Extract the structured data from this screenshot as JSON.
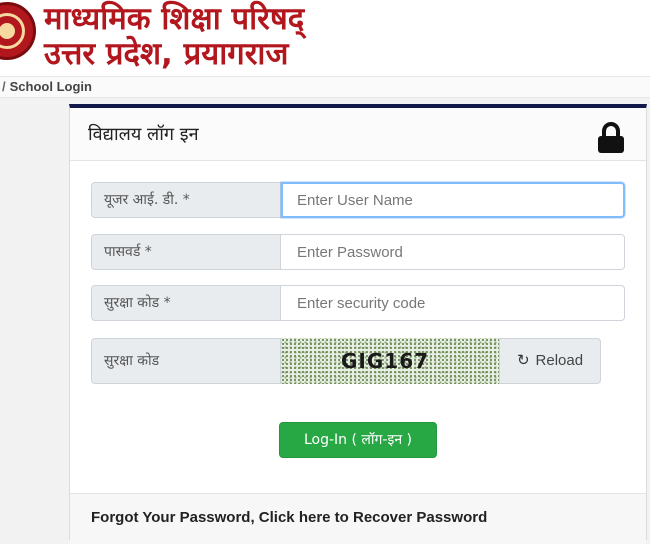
{
  "header": {
    "title_line1": "माध्यमिक शिक्षा परिषद्",
    "title_line2": "उत्तर प्रदेश, प्रयागराज",
    "brand_color": "#b3171e"
  },
  "breadcrumb": {
    "separator": "/",
    "current": "School Login"
  },
  "card": {
    "title": "विद्यालय लॉग इन",
    "lock_icon": "lock-icon",
    "accent_color": "#12194a"
  },
  "form": {
    "user_id": {
      "label": "यूजर आई. डी. *",
      "placeholder": "Enter User Name",
      "value": ""
    },
    "password": {
      "label": "पासवर्ड *",
      "placeholder": "Enter Password",
      "value": ""
    },
    "security_code": {
      "label": "सुरक्षा कोड *",
      "placeholder": "Enter security code",
      "value": ""
    },
    "captcha": {
      "label": "सुरक्षा कोड",
      "text": "GIG167",
      "reload_label": "Reload",
      "reload_icon": "refresh-icon"
    },
    "login_button": "Log-In ( लॉग-इन )",
    "login_color": "#28a745"
  },
  "footer": {
    "forgot_link": "Forgot Your Password, Click here to Recover Password"
  }
}
